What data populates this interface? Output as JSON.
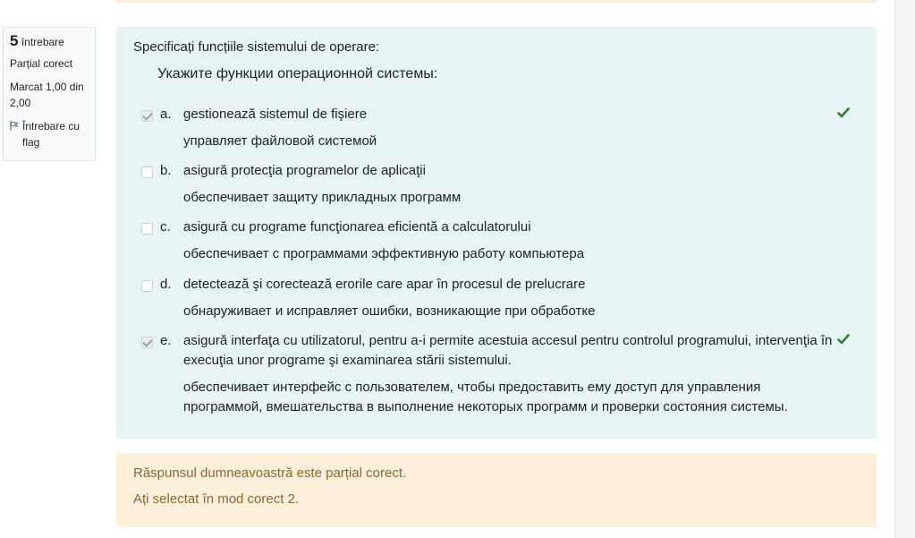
{
  "info": {
    "number": "5",
    "number_label": "întrebare",
    "state": "Parțial corect",
    "grade": "Marcat 1,00 din 2,00",
    "flag_label": "Întrebare cu flag"
  },
  "question": {
    "text_ro": "Specificați funcțiile sistemului de operare:",
    "text_ru": "Укажите функции операционной системы:"
  },
  "options": [
    {
      "letter": "a.",
      "text_ro": "gestionează sistemul de fişiere",
      "text_ru": "управляет файловой системой",
      "checked": true,
      "correct": true
    },
    {
      "letter": "b.",
      "text_ro": "asigură protecţia programelor de aplicaţii",
      "text_ru": "обеспечивает защиту прикладных программ",
      "checked": false,
      "correct": false
    },
    {
      "letter": "c.",
      "text_ro": "asigură cu programe funcţionarea eficientă a calculatorului",
      "text_ru": " обеспечивает с программами эффективную работу компьютера",
      "checked": false,
      "correct": false
    },
    {
      "letter": "d.",
      "text_ro": "detectează şi corectează erorile care apar în procesul de prelucrare",
      "text_ru": "обнаруживает и исправляет ошибки, возникающие при обработке",
      "checked": false,
      "correct": false
    },
    {
      "letter": "e.",
      "text_ro": "asigură interfaţa cu utilizatorul, pentru a-i permite acestuia accesul pentru controlul programului, intervenţia în execuţia unor programe şi examinarea stării sistemului.",
      "text_ru": "обеспечивает интерфейс с пользователем, чтобы предоставить ему доступ для управления программой, вмешательства в выполнение некоторых программ и проверки состояния системы.",
      "checked": true,
      "correct": true
    }
  ],
  "feedback": {
    "partial": "Răspunsul dumneavoastră este parțial corect.",
    "selected": "Ați selectat în mod corect 2."
  },
  "colors": {
    "formulation_bg": "#e7f3f5",
    "feedback_bg": "#fcefdc",
    "feedback_text": "#8e662e",
    "correct_icon": "#357a32"
  }
}
